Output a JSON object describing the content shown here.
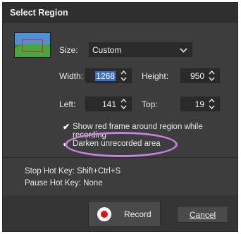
{
  "dialog": {
    "title": "Select Region"
  },
  "size": {
    "label": "Size:",
    "value": "Custom"
  },
  "width": {
    "label": "Width:",
    "value": "1268"
  },
  "height": {
    "label": "Height:",
    "value": "950"
  },
  "left": {
    "label": "Left:",
    "value": "141"
  },
  "top": {
    "label": "Top:",
    "value": "19"
  },
  "options": {
    "show_frame": {
      "label": "Show red frame around region while recording",
      "checked": true
    },
    "darken": {
      "label": "Darken unrecorded area",
      "checked": true
    }
  },
  "hotkeys": {
    "stop": "Stop Hot Key: Shift+Ctrl+S",
    "pause": "Pause Hot Key: None"
  },
  "buttons": {
    "record": "Record",
    "cancel": "Cancel"
  },
  "colors": {
    "highlight_ellipse": "#c77fe0",
    "record_red": "#e01414",
    "selection_blue": "#3b6ec4"
  }
}
